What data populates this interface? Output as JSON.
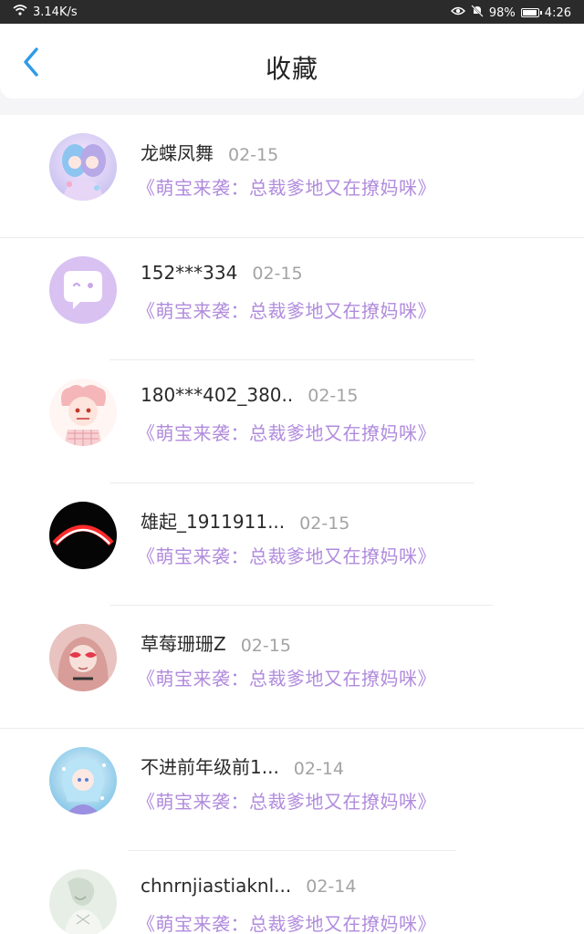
{
  "status": {
    "speed": "3.14K/s",
    "battery": "98%",
    "time": "4:26"
  },
  "header": {
    "title": "收藏"
  },
  "colors": {
    "accent": "#2f9be8",
    "book_title": "#b08bdc"
  },
  "items": [
    {
      "name": "龙蝶凤舞",
      "date": "02-15",
      "book": "《萌宝来袭：总裁爹地又在撩妈咪》",
      "avatar": "anime-girl-lavender"
    },
    {
      "name": "152***334",
      "date": "02-15",
      "book": "《萌宝来袭：总裁爹地又在撩妈咪》",
      "avatar": "chat-bubble-default"
    },
    {
      "name": "180***402_380..",
      "date": "02-15",
      "book": "《萌宝来袭：总裁爹地又在撩妈咪》",
      "avatar": "anime-girl-pink"
    },
    {
      "name": "雄起_1911911...",
      "date": "02-15",
      "book": "《萌宝来袭：总裁爹地又在撩妈咪》",
      "avatar": "red-arc-black"
    },
    {
      "name": "草莓珊珊Z",
      "date": "02-15",
      "book": "《萌宝来袭：总裁爹地又在撩妈咪》",
      "avatar": "girl-heart-glasses"
    },
    {
      "name": "不进前年级前1...",
      "date": "02-14",
      "book": "《萌宝来袭：总裁爹地又在撩妈咪》",
      "avatar": "anime-girl-blue"
    },
    {
      "name": "chnrnjiastiaknl...",
      "date": "02-14",
      "book": "《萌宝来袭：总裁爹地又在撩妈咪》",
      "avatar": "sketch-figure"
    }
  ]
}
